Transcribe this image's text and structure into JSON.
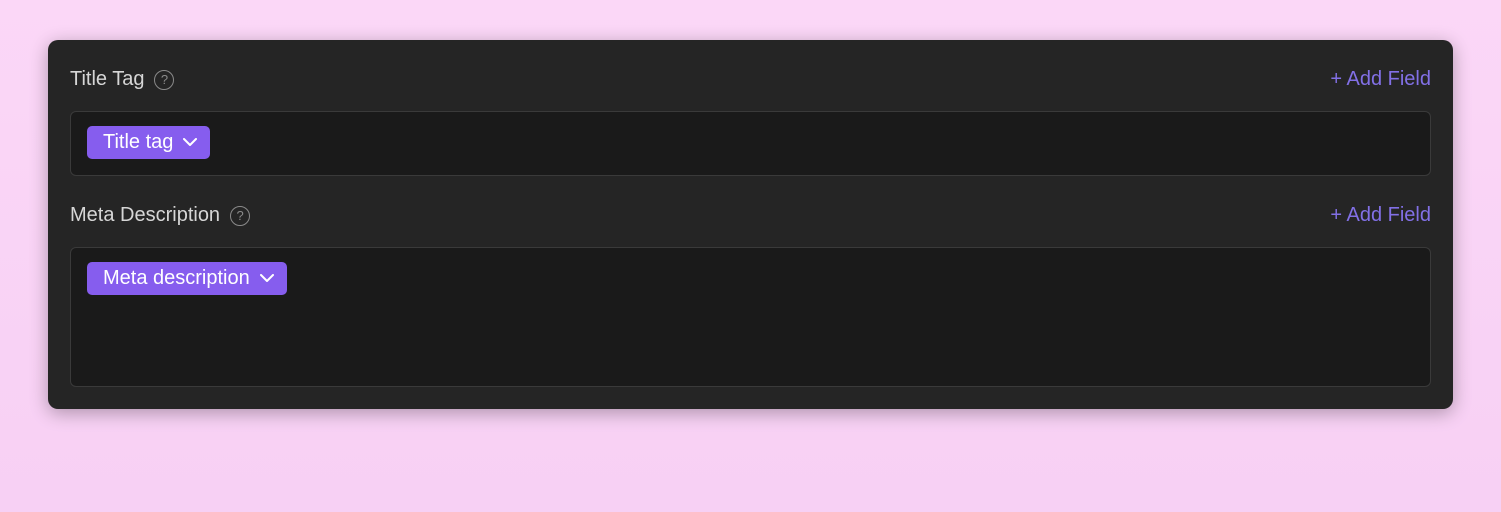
{
  "sections": [
    {
      "label": "Title Tag",
      "addFieldLabel": "+ Add Field",
      "chipLabel": "Title tag",
      "tall": false
    },
    {
      "label": "Meta Description",
      "addFieldLabel": "+ Add Field",
      "chipLabel": "Meta description",
      "tall": true
    }
  ]
}
